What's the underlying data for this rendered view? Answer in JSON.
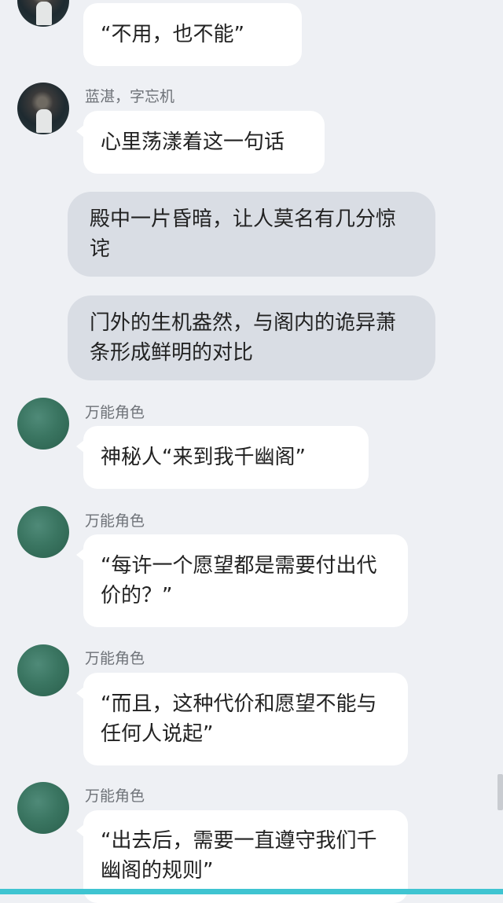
{
  "messages": [
    {
      "type": "user",
      "avatar": "portrait-avatar",
      "sender": "",
      "text": "“不用，也不能”"
    },
    {
      "type": "user",
      "avatar": "portrait-avatar",
      "sender": "蓝湛，字忘机",
      "text": "心里荡漾着这一句话"
    },
    {
      "type": "narration",
      "text": "殿中一片昏暗，让人莫名有几分惊诧"
    },
    {
      "type": "narration",
      "text": "门外的生机盎然，与阁内的诡异萧条形成鲜明的对比"
    },
    {
      "type": "user",
      "avatar": "green-avatar",
      "sender": "万能角色",
      "text": "神秘人“来到我千幽阁”"
    },
    {
      "type": "user",
      "avatar": "green-avatar",
      "sender": "万能角色",
      "text": "“每许一个愿望都是需要付出代价的？”"
    },
    {
      "type": "user",
      "avatar": "green-avatar",
      "sender": "万能角色",
      "text": "“而且，这种代价和愿望不能与任何人说起”"
    },
    {
      "type": "user",
      "avatar": "green-avatar",
      "sender": "万能角色",
      "text": "“出去后，需要一直遵守我们千幽阁的规则”"
    }
  ],
  "colors": {
    "background": "#eef0f4",
    "bubble": "#ffffff",
    "narration_bubble": "#d9dde4",
    "accent_bar": "#3fc4d1"
  }
}
